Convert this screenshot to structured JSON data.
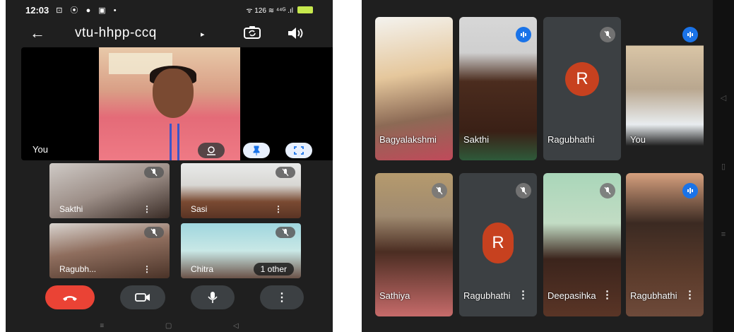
{
  "left_phone": {
    "status_bar": {
      "time": "12:03",
      "icons": "⊡ ⦿ ● ▣ •",
      "right": "ᯤ 126 ≋ ⁴⁴ᴳ .ıl"
    },
    "header": {
      "meeting_code": "vtu-hhpp-ccq",
      "caret": "▸"
    },
    "main_tile": {
      "label": "You"
    },
    "tiles": [
      {
        "name": "Sakthi",
        "dots": "⋮"
      },
      {
        "name": "Sasi",
        "dots": "⋮"
      },
      {
        "name": "Ragubh...",
        "dots": "⋮"
      },
      {
        "name": "Chitra",
        "overlay": "1 other"
      }
    ],
    "controls": {
      "more": "⋮"
    },
    "nav": {
      "menu": "≡",
      "home": "▢",
      "back": "◁"
    }
  },
  "right_tablet": {
    "tiles": [
      {
        "name": "Bagyalakshmi",
        "status": "none"
      },
      {
        "name": "Sakthi",
        "status": "speaking"
      },
      {
        "name": "Ragubhathi",
        "status": "muted",
        "avatar": "R"
      },
      {
        "name": "You",
        "status": "speaking"
      },
      {
        "name": "Sathiya",
        "status": "muted"
      },
      {
        "name": "Ragubhathi",
        "status": "muted",
        "avatar": "R",
        "dots": "⋮"
      },
      {
        "name": "Deepasihka",
        "status": "muted",
        "dots": "⋮"
      },
      {
        "name": "Ragubhathi",
        "status": "speaking",
        "dots": "⋮"
      }
    ],
    "sidebar": {
      "back": "◁",
      "home": "▯",
      "menu": "≡"
    }
  },
  "colors": {
    "end_call": "#ea4335",
    "avatar": "#c7411f",
    "speaking": "#1a73e8",
    "background": "#1f1f1f"
  }
}
